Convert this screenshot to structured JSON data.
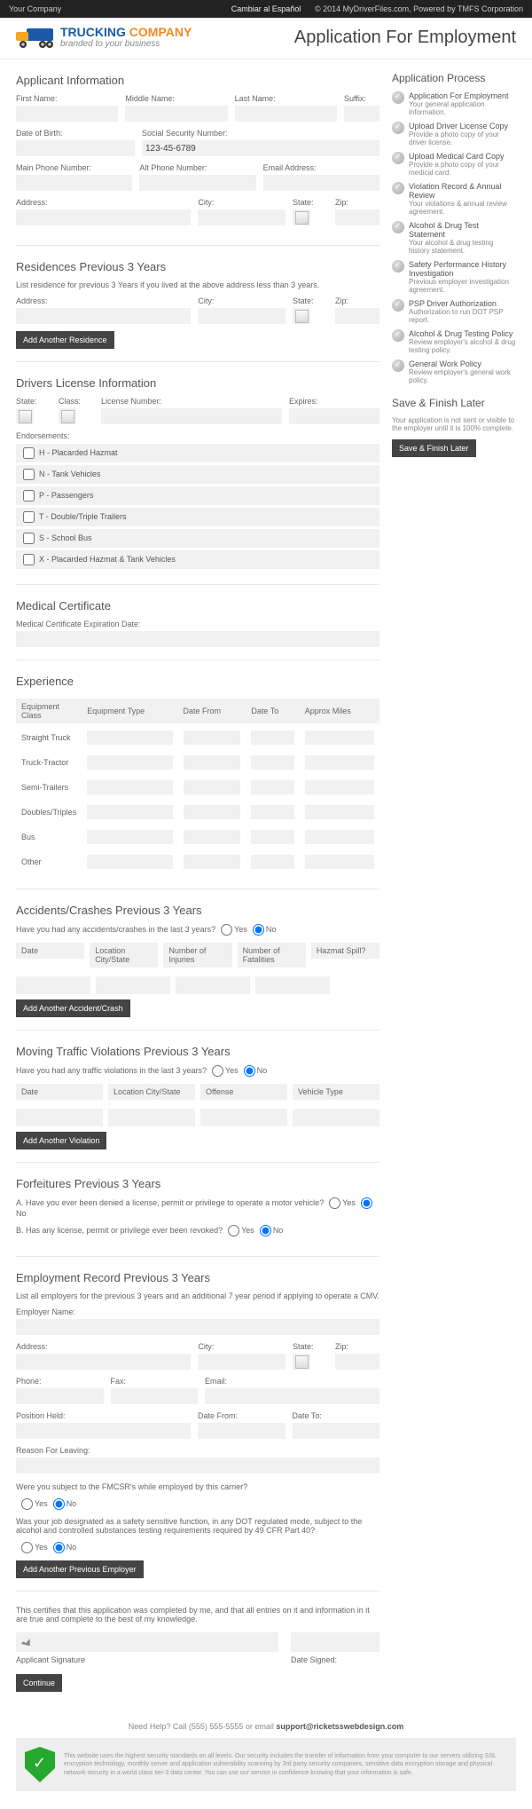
{
  "topbar": {
    "left": "Your Company",
    "center": "Cambiar al Español",
    "right": "© 2014 MyDriverFiles.com, Powered by TMFS Corporation"
  },
  "logo": {
    "line1a": "TRUCKING ",
    "line1b": "COMPANY",
    "line2": "branded to your business"
  },
  "pageTitle": "Application For Employment",
  "applicant": {
    "heading": "Applicant Information",
    "firstName": "First Name:",
    "middleName": "Middle Name:",
    "lastName": "Last Name:",
    "suffix": "Suffix:",
    "dob": "Date of Birth:",
    "ssn": "Social Security Number:",
    "ssnValue": "123-45-6789",
    "mainPhone": "Main Phone Number:",
    "altPhone": "Alt Phone Number:",
    "email": "Email Address:",
    "address": "Address:",
    "city": "City:",
    "state": "State:",
    "zip": "Zip:"
  },
  "residences": {
    "heading": "Residences Previous 3 Years",
    "desc": "List residence for previous 3 Years if you lived at the above address less than 3 years.",
    "address": "Address:",
    "city": "City:",
    "state": "State:",
    "zip": "Zip:",
    "btn": "Add Another Residence"
  },
  "license": {
    "heading": "Drivers License Information",
    "state": "State:",
    "class": "Class:",
    "number": "License Number:",
    "expires": "Expires:",
    "endLabel": "Endorsements:",
    "endorsements": [
      "H - Placarded Hazmat",
      "N - Tank Vehicles",
      "P - Passengers",
      "T - Double/Triple Trailers",
      "S - School Bus",
      "X - Placarded Hazmat & Tank Vehicles"
    ]
  },
  "medical": {
    "heading": "Medical Certificate",
    "label": "Medical Certificate Expiration Date:"
  },
  "experience": {
    "heading": "Experience",
    "cols": [
      "Equipment Class",
      "Equipment Type",
      "Date From",
      "Date To",
      "Approx Miles"
    ],
    "rows": [
      "Straight Truck",
      "Truck-Tractor",
      "Semi-Trailers",
      "Doubles/Triples",
      "Bus",
      "Other"
    ]
  },
  "accidents": {
    "heading": "Accidents/Crashes Previous 3 Years",
    "q": "Have you had any accidents/crashes in the last 3 years?",
    "yes": "Yes",
    "no": "No",
    "cols": [
      "Date",
      "Location City/State",
      "Number of Injuries",
      "Number of Fatalities",
      "Hazmat Spill?"
    ],
    "btn": "Add Another Accident/Crash"
  },
  "violations": {
    "heading": "Moving Traffic Violations Previous 3 Years",
    "q": "Have you had any traffic violations in the last 3 years?",
    "yes": "Yes",
    "no": "No",
    "cols": [
      "Date",
      "Location City/State",
      "Offense",
      "Vehicle Type"
    ],
    "btn": "Add Another Violation"
  },
  "forfeitures": {
    "heading": "Forfeitures Previous 3 Years",
    "qa": "A. Have you ever been denied a license, permit or privilege to operate a motor vehicle?",
    "qb": "B. Has any license, permit or privilege ever been revoked?",
    "yes": "Yes",
    "no": "No"
  },
  "employment": {
    "heading": "Employment Record Previous 3 Years",
    "desc": "List all employers for the previous 3 years and an additional 7 year period if applying to operate a CMV.",
    "employer": "Employer Name:",
    "address": "Address:",
    "city": "City:",
    "state": "State:",
    "zip": "Zip:",
    "phone": "Phone:",
    "fax": "Fax:",
    "email": "Email:",
    "position": "Position Held:",
    "from": "Date From:",
    "to": "Date To:",
    "reason": "Reason For Leaving:",
    "q1": "Were you subject to the FMCSR's while employed by this carrier?",
    "q2": "Was your job designated as a safety sensitive function, in any DOT regulated mode, subject to the alcohol and controlled substances testing requirements required by 49 CFR Part 40?",
    "yes": "Yes",
    "no": "No",
    "btn": "Add Another Previous Employer"
  },
  "cert": {
    "text": "This certifies that this application was completed by me, and that all entries on it and information in it are true and complete to the best of my knowledge.",
    "sig": "Applicant Signature",
    "date": "Date Signed:",
    "btn": "Continue"
  },
  "process": {
    "heading": "Application Process",
    "items": [
      {
        "t": "Application For Employment",
        "s": "Your general application information."
      },
      {
        "t": "Upload Driver License Copy",
        "s": "Provide a photo copy of your driver license."
      },
      {
        "t": "Upload Medical Card Copy",
        "s": "Provide a photo copy of your medical card."
      },
      {
        "t": "Violation Record & Annual Review",
        "s": "Your violations & annual review agreement."
      },
      {
        "t": "Alcohol & Drug Test Statement",
        "s": "Your alcohol & drug testing history statement."
      },
      {
        "t": "Safety Performance History Investigation",
        "s": "Previous employer investigation agreement."
      },
      {
        "t": "PSP Driver Authorization",
        "s": "Authorization to run DOT PSP report."
      },
      {
        "t": "Alcohol & Drug Testing Policy",
        "s": "Review employer's alcohol & drug testing policy."
      },
      {
        "t": "General Work Policy",
        "s": "Review employer's general work policy."
      }
    ]
  },
  "save": {
    "heading": "Save & Finish Later",
    "desc": "Your application is not sent or visible to the employer until it is 100% complete.",
    "btn": "Save & Finish Later"
  },
  "footer": {
    "help": "Need Help? Call (555) 555-5555 or email ",
    "email": "support@ricketsswebdesign.com",
    "sec": "This website uses the highest security standards on all levels. Our security includes the transfer of information from your computer to our servers utilizing SSL encryption technology, monthly server and application vulnerability scanning by 3rd party security companies, sensitive data encryption storage and physical network security in a world class tier-3 data center. You can use our service in confidence knowing that your information is safe."
  }
}
